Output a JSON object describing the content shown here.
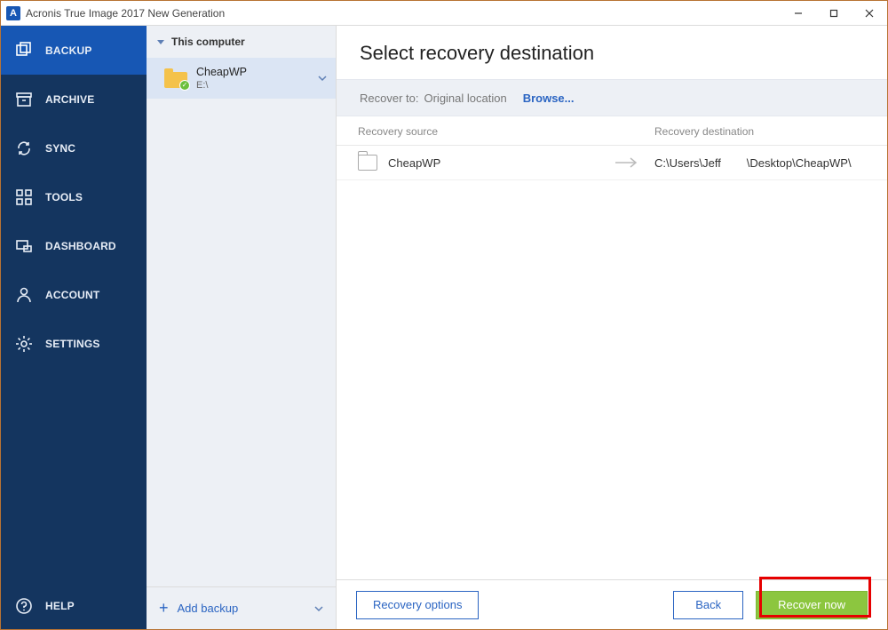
{
  "window": {
    "title": "Acronis True Image 2017 New Generation"
  },
  "nav": {
    "items": [
      {
        "key": "backup",
        "label": "BACKUP",
        "active": true
      },
      {
        "key": "archive",
        "label": "ARCHIVE",
        "active": false
      },
      {
        "key": "sync",
        "label": "SYNC",
        "active": false
      },
      {
        "key": "tools",
        "label": "TOOLS",
        "active": false
      },
      {
        "key": "dashboard",
        "label": "DASHBOARD",
        "active": false
      },
      {
        "key": "account",
        "label": "ACCOUNT",
        "active": false
      },
      {
        "key": "settings",
        "label": "SETTINGS",
        "active": false
      }
    ],
    "help_label": "HELP"
  },
  "mid": {
    "group_label": "This computer",
    "backup": {
      "name": "CheapWP",
      "subtitle": "E:\\"
    },
    "add_backup_label": "Add backup"
  },
  "main": {
    "heading": "Select recovery destination",
    "recover_to_label": "Recover to:",
    "recover_to_value": "Original location",
    "browse_label": "Browse...",
    "col_source": "Recovery source",
    "col_dest": "Recovery destination",
    "row": {
      "source_name": "CheapWP",
      "dest_path": "C:\\Users\\Jeff        \\Desktop\\CheapWP\\"
    },
    "footer": {
      "options_label": "Recovery options",
      "back_label": "Back",
      "recover_label": "Recover now"
    }
  },
  "colors": {
    "nav_bg": "#14355f",
    "nav_active": "#1757b4",
    "accent_blue": "#2a64c2",
    "accent_green": "#8cc63f",
    "highlight_red": "#e60000"
  }
}
